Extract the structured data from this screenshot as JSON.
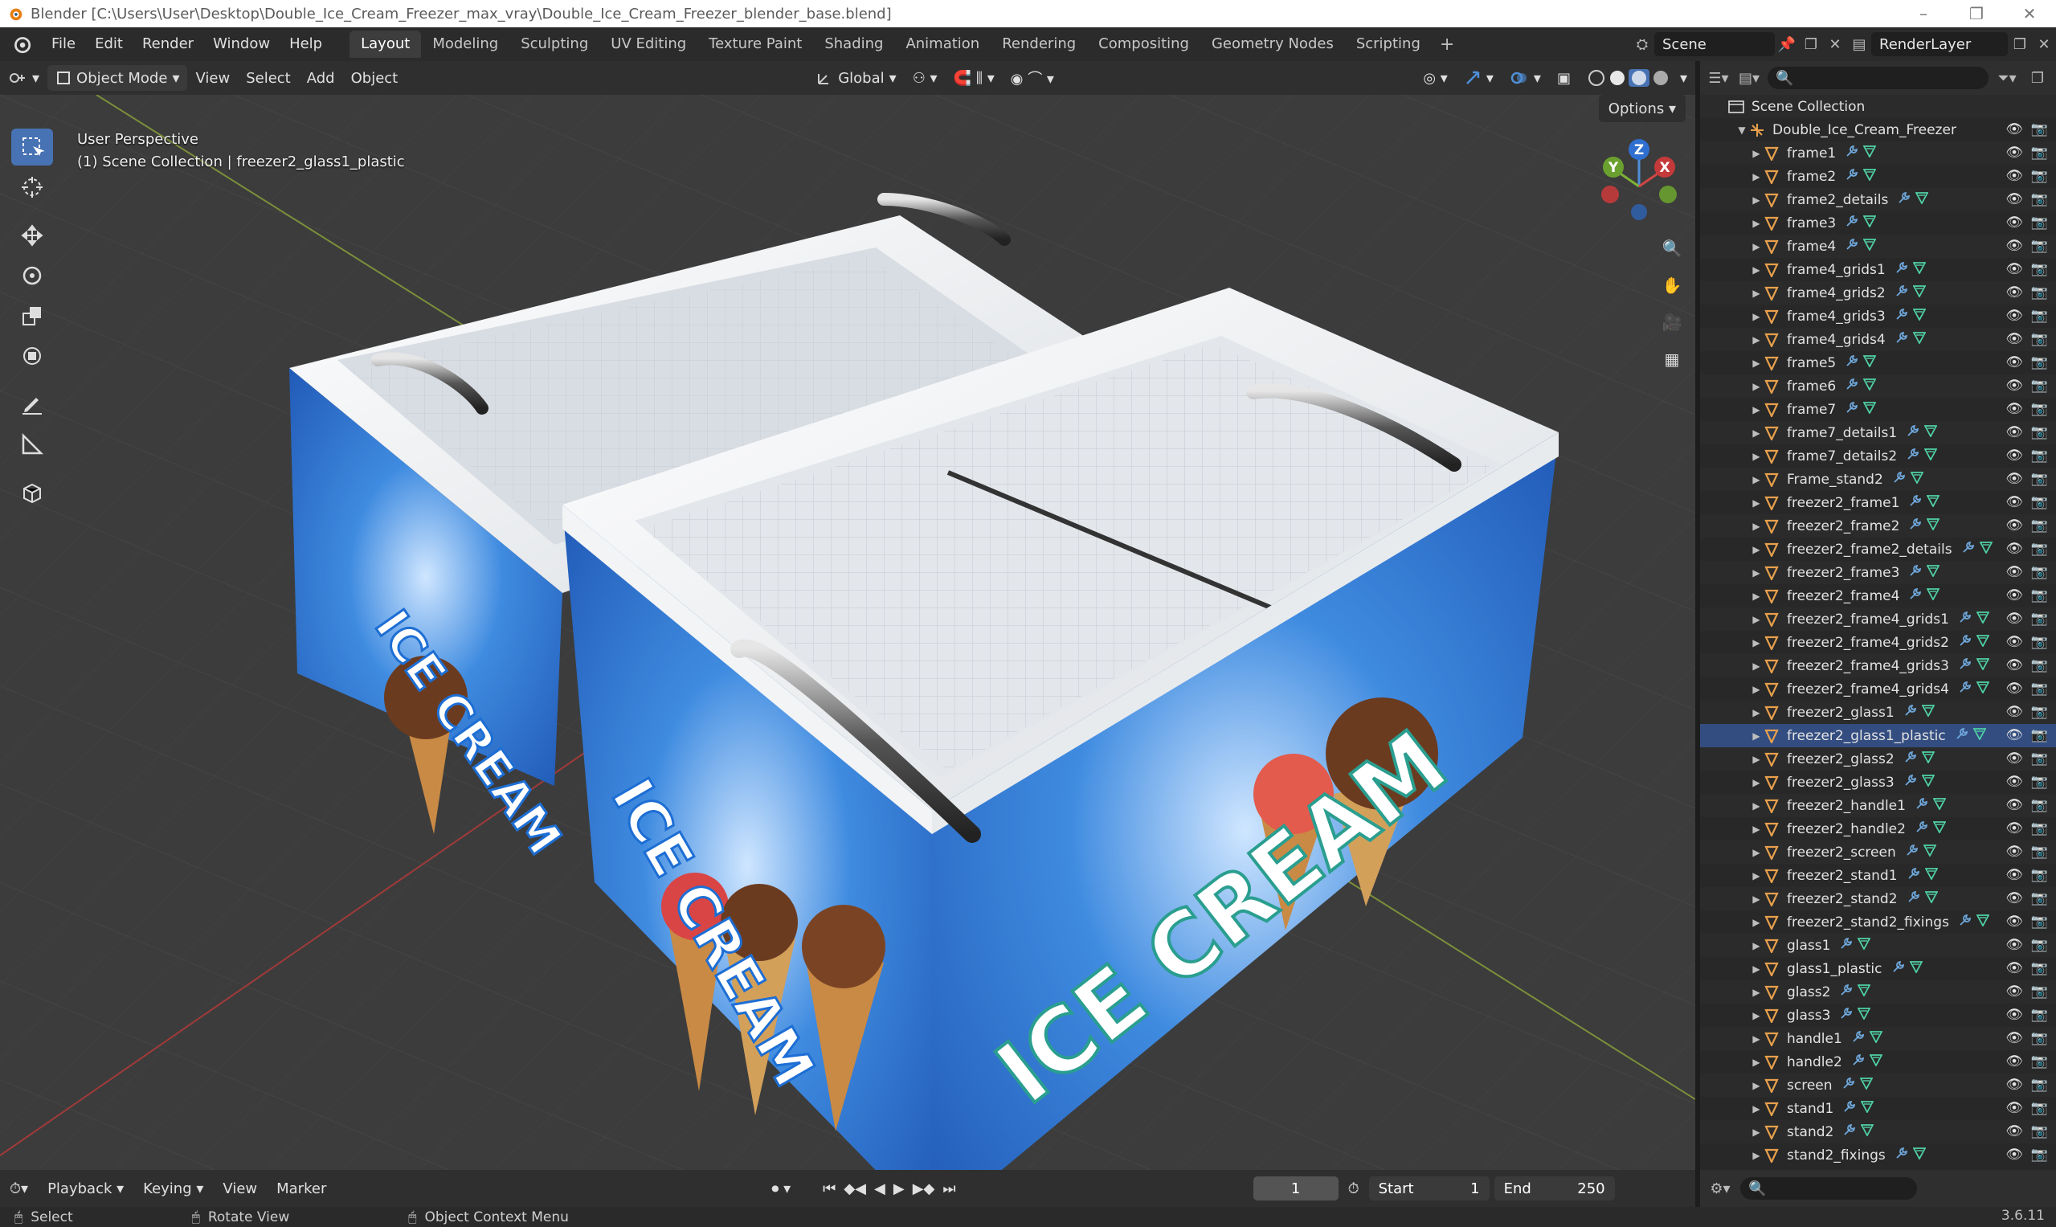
{
  "window": {
    "title": "Blender [C:\\Users\\User\\Desktop\\Double_Ice_Cream_Freezer_max_vray\\Double_Ice_Cream_Freezer_blender_base.blend]"
  },
  "menu": [
    "File",
    "Edit",
    "Render",
    "Window",
    "Help"
  ],
  "workspaces": [
    "Layout",
    "Modeling",
    "Sculpting",
    "UV Editing",
    "Texture Paint",
    "Shading",
    "Animation",
    "Rendering",
    "Compositing",
    "Geometry Nodes",
    "Scripting"
  ],
  "active_workspace": "Layout",
  "scene": {
    "name": "Scene",
    "view_layer": "RenderLayer"
  },
  "viewport_header": {
    "mode": "Object Mode",
    "view": "View",
    "select": "Select",
    "add": "Add",
    "object": "Object",
    "transform_orientation": "Global",
    "options": "Options"
  },
  "viewport": {
    "perspective": "User Perspective",
    "context": "(1) Scene Collection | freezer2_glass1_plastic",
    "decal_text": "ICE CREAM",
    "gizmo": {
      "x": "X",
      "y": "Y",
      "z": "Z"
    }
  },
  "outliner": {
    "root": "Scene Collection",
    "parent": "Double_Ice_Cream_Freezer",
    "selected": "freezer2_glass1_plastic",
    "items": [
      "frame1",
      "frame2",
      "frame2_details",
      "frame3",
      "frame4",
      "frame4_grids1",
      "frame4_grids2",
      "frame4_grids3",
      "frame4_grids4",
      "frame5",
      "frame6",
      "frame7",
      "frame7_details1",
      "frame7_details2",
      "Frame_stand2",
      "freezer2_frame1",
      "freezer2_frame2",
      "freezer2_frame2_details",
      "freezer2_frame3",
      "freezer2_frame4",
      "freezer2_frame4_grids1",
      "freezer2_frame4_grids2",
      "freezer2_frame4_grids3",
      "freezer2_frame4_grids4",
      "freezer2_glass1",
      "freezer2_glass1_plastic",
      "freezer2_glass2",
      "freezer2_glass3",
      "freezer2_handle1",
      "freezer2_handle2",
      "freezer2_screen",
      "freezer2_stand1",
      "freezer2_stand2",
      "freezer2_stand2_fixings",
      "glass1",
      "glass1_plastic",
      "glass2",
      "glass3",
      "handle1",
      "handle2",
      "screen",
      "stand1",
      "stand2",
      "stand2_fixings"
    ]
  },
  "timeline": {
    "playback": "Playback",
    "keying": "Keying",
    "view": "View",
    "marker": "Marker",
    "current_frame": "1",
    "start_label": "Start",
    "start": "1",
    "end_label": "End",
    "end": "250"
  },
  "statusbar": {
    "select": "Select",
    "rotate": "Rotate View",
    "context_menu": "Object Context Menu",
    "version": "3.6.11"
  },
  "colors": {
    "accent": "#4772b3",
    "selected_row": "#334d80",
    "object_icon": "#e8a04c",
    "modifier_icon": "#6fa8dc",
    "mesh_icon": "#4fd1a5"
  }
}
